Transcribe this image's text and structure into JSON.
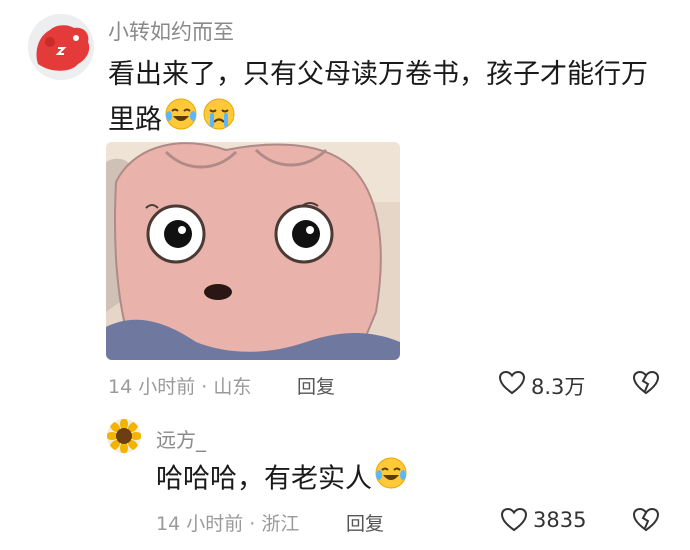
{
  "comment": {
    "username": "小转如约而至",
    "text": "看出来了，只有父母读万卷书，孩子才能行万里路",
    "emojis": [
      "laugh-cry-icon",
      "crying-icon"
    ],
    "time": "14 小时前",
    "location": "山东",
    "reply_label": "回复",
    "like_count": "8.3万"
  },
  "reply": {
    "username": "远方_",
    "text": "哈哈哈，有老实人",
    "emojis": [
      "laugh-cry-icon"
    ],
    "time": "14 小时前",
    "location": "浙江",
    "reply_label": "回复",
    "like_count": "3835"
  },
  "colors": {
    "meta_text": "#9a9a9a",
    "username_text": "#8a8a8a",
    "body_text": "#1a1a1a",
    "avatar_red": "#e53a3a"
  }
}
